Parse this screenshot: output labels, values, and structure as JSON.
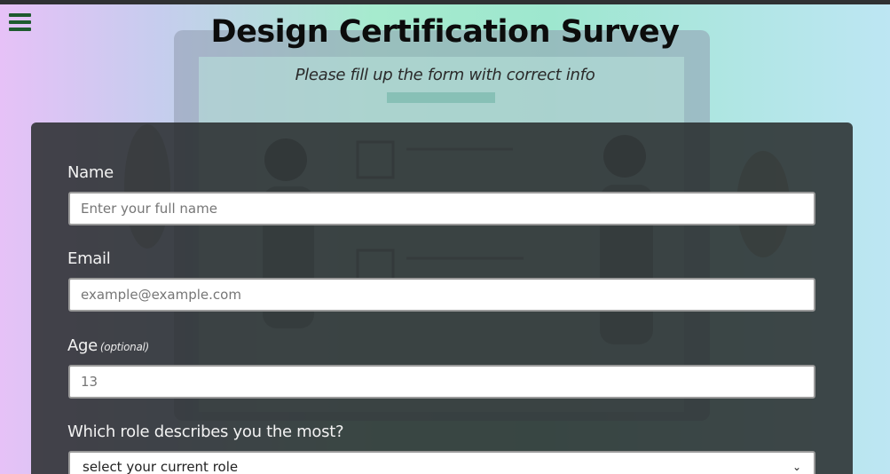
{
  "header": {
    "title": "Design Certification Survey",
    "subtitle": "Please fill up the form with correct info"
  },
  "menu": {
    "icon": "hamburger-menu-icon"
  },
  "form": {
    "name": {
      "label": "Name",
      "placeholder": "Enter your full name"
    },
    "email": {
      "label": "Email",
      "placeholder": "example@example.com"
    },
    "age": {
      "label": "Age",
      "optional_note": "(optional)",
      "placeholder": "13"
    },
    "role": {
      "label": "Which role describes you the most?",
      "selected": "select your current role"
    }
  },
  "colors": {
    "menu_icon": "#1e5a2e",
    "card_bg": "#282b2c",
    "label_text": "#f2f2f2"
  }
}
